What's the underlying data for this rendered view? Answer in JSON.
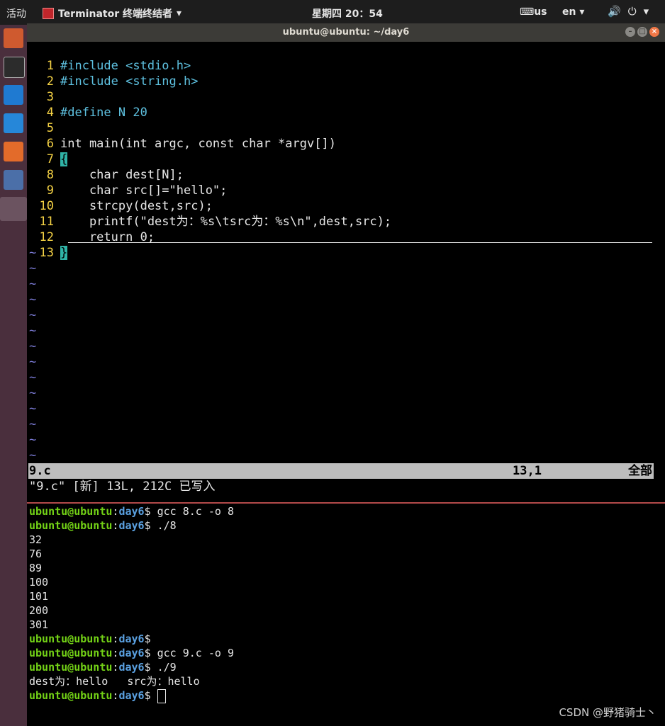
{
  "topbar": {
    "activities": "活动",
    "app_name": "Terminator 终端终结者",
    "clock": "星期四 20：54",
    "keyboard": "us",
    "lang": "en"
  },
  "window": {
    "title": "ubuntu@ubuntu: ~/day6"
  },
  "vim": {
    "lines": [
      {
        "n": "1",
        "t": "#include <stdio.h>"
      },
      {
        "n": "2",
        "t": "#include <string.h>"
      },
      {
        "n": "3",
        "t": ""
      },
      {
        "n": "4",
        "t": "#define N 20"
      },
      {
        "n": "5",
        "t": ""
      },
      {
        "n": "6",
        "t": "int main(int argc, const char *argv[])"
      },
      {
        "n": "7",
        "t": "{"
      },
      {
        "n": "8",
        "t": "    char dest[N];"
      },
      {
        "n": "9",
        "t": "    char src[]=\"hello\";"
      },
      {
        "n": "10",
        "t": "    strcpy(dest,src);"
      },
      {
        "n": "11",
        "t": "    printf(\"dest为：%s\\tsrc为：%s\\n\",dest,src);"
      },
      {
        "n": "12",
        "t": "    return 0;"
      },
      {
        "n": "13",
        "t": "}"
      }
    ],
    "tilde_count": 14,
    "status": {
      "filename": "9.c",
      "position": "13,1",
      "scroll": "全部"
    },
    "message": "\"9.c\" [新] 13L, 212C 已写入"
  },
  "terminal": {
    "user": "ubuntu@ubuntu",
    "dir": "day6",
    "lines": [
      {
        "type": "cmd",
        "cmd": "gcc 8.c -o 8"
      },
      {
        "type": "cmd",
        "cmd": "./8"
      },
      {
        "type": "out",
        "text": "32"
      },
      {
        "type": "out",
        "text": "76"
      },
      {
        "type": "out",
        "text": "89"
      },
      {
        "type": "out",
        "text": "100"
      },
      {
        "type": "out",
        "text": "101"
      },
      {
        "type": "out",
        "text": "200"
      },
      {
        "type": "out",
        "text": "301"
      },
      {
        "type": "cmd",
        "cmd": ""
      },
      {
        "type": "cmd",
        "cmd": "gcc 9.c -o 9"
      },
      {
        "type": "cmd",
        "cmd": "./9"
      },
      {
        "type": "out",
        "text": "dest为：hello   src为：hello"
      },
      {
        "type": "cmd",
        "cmd": "",
        "cursor": true
      }
    ]
  },
  "watermark": "CSDN @野猪骑士丶"
}
